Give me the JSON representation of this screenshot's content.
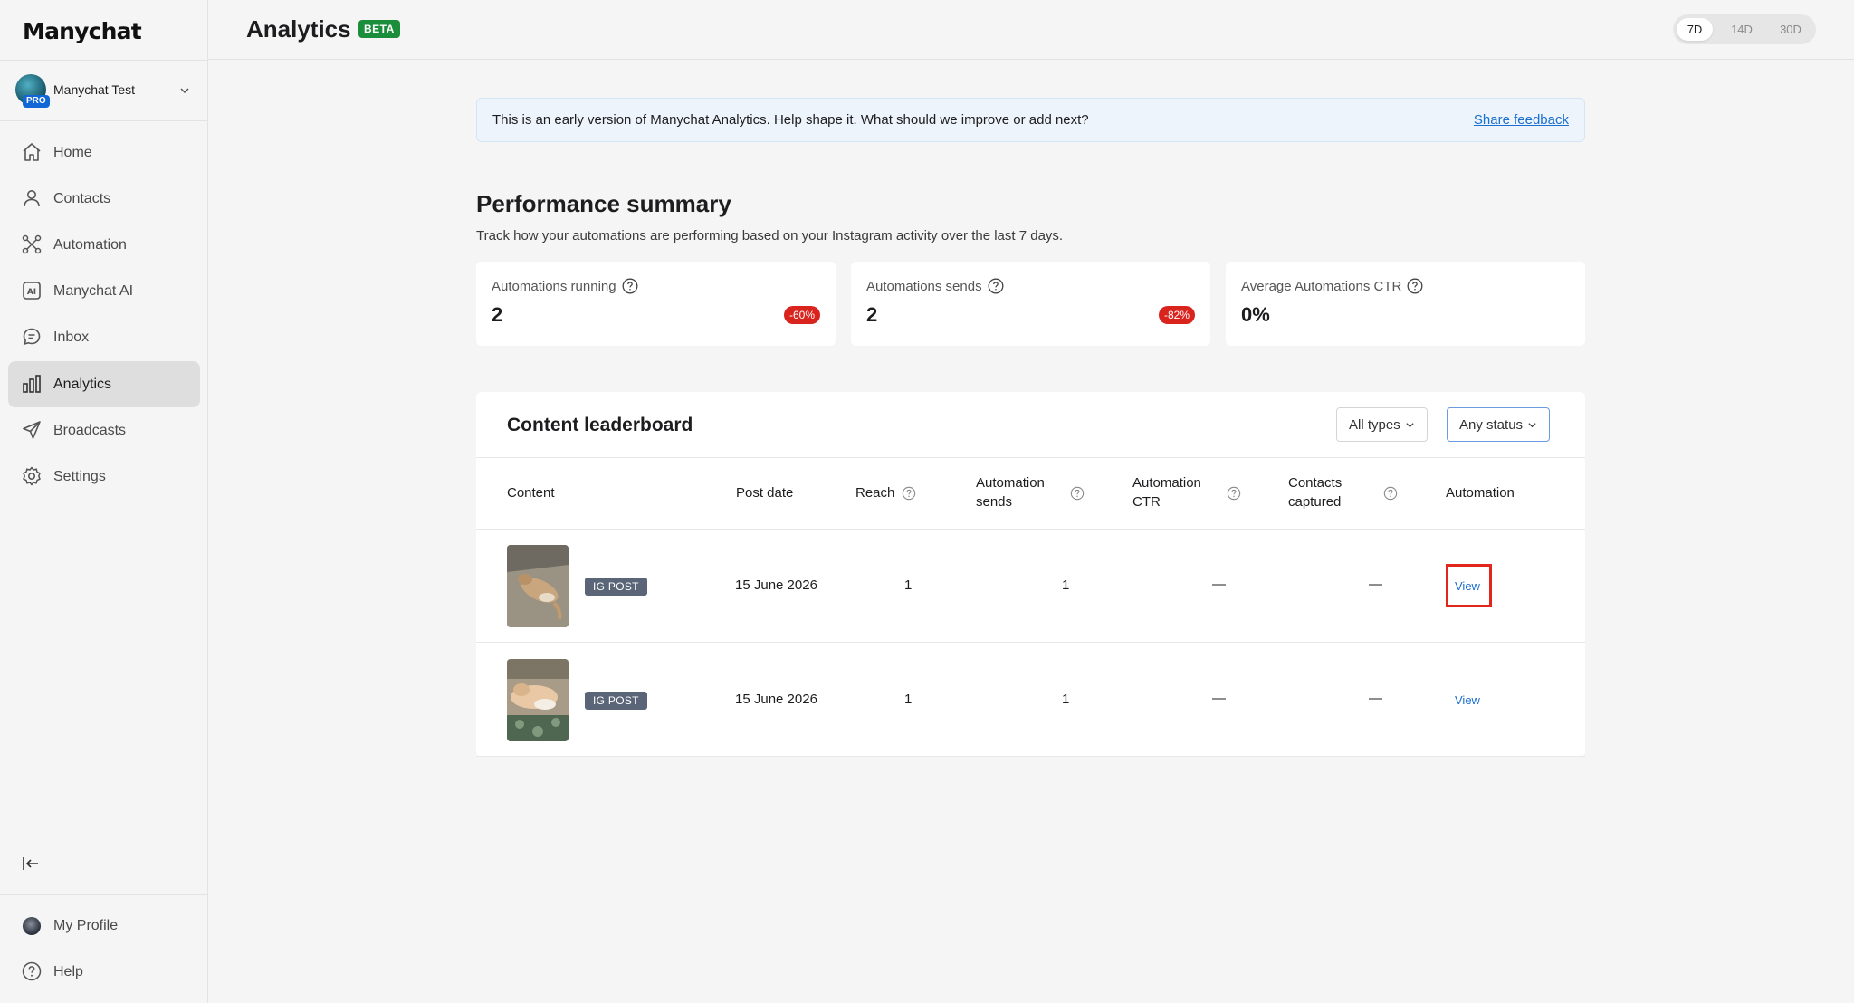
{
  "sidebar": {
    "logo": "Manychat",
    "account": {
      "name": "Manychat Test",
      "badge": "PRO"
    },
    "items": [
      {
        "label": "Home",
        "icon": "home-icon",
        "active": false
      },
      {
        "label": "Contacts",
        "icon": "person-icon",
        "active": false
      },
      {
        "label": "Automation",
        "icon": "automation-icon",
        "active": false
      },
      {
        "label": "Manychat AI",
        "icon": "ai-icon",
        "active": false
      },
      {
        "label": "Inbox",
        "icon": "chat-bubble-icon",
        "active": false
      },
      {
        "label": "Analytics",
        "icon": "bar-chart-icon",
        "active": true
      },
      {
        "label": "Broadcasts",
        "icon": "send-icon",
        "active": false
      },
      {
        "label": "Settings",
        "icon": "gear-icon",
        "active": false
      }
    ],
    "bottom": [
      {
        "label": "My Profile",
        "icon": "avatar"
      },
      {
        "label": "Help",
        "icon": "help-icon"
      }
    ]
  },
  "header": {
    "title": "Analytics",
    "badge": "BETA",
    "ranges": [
      "7D",
      "14D",
      "30D"
    ],
    "active_range": "7D"
  },
  "banner": {
    "text": "This is an early version of Manychat Analytics. Help shape it. What should we improve or add next?",
    "link": "Share feedback"
  },
  "performance": {
    "title": "Performance summary",
    "subtitle": "Track how your automations are performing based on your Instagram activity over the last 7 days.",
    "cards": [
      {
        "label": "Automations running",
        "value": "2",
        "delta": "-60%"
      },
      {
        "label": "Automations sends",
        "value": "2",
        "delta": "-82%"
      },
      {
        "label": "Average Automations CTR",
        "value": "0%",
        "delta": ""
      }
    ]
  },
  "leaderboard": {
    "title": "Content leaderboard",
    "filters": {
      "type": "All types",
      "status": "Any status"
    },
    "columns": {
      "content": "Content",
      "post_date": "Post date",
      "reach": "Reach",
      "sends_1": "Automation",
      "sends_2": "sends",
      "ctr_1": "Automation",
      "ctr_2": "CTR",
      "contacts_1": "Contacts",
      "contacts_2": "captured",
      "automation": "Automation"
    },
    "rows": [
      {
        "type": "IG POST",
        "post_date": "15 June 2026",
        "reach": "1",
        "sends": "1",
        "ctr": "—",
        "contacts": "—",
        "action": "View"
      },
      {
        "type": "IG POST",
        "post_date": "15 June 2026",
        "reach": "1",
        "sends": "1",
        "ctr": "—",
        "contacts": "—",
        "action": "View"
      }
    ]
  }
}
